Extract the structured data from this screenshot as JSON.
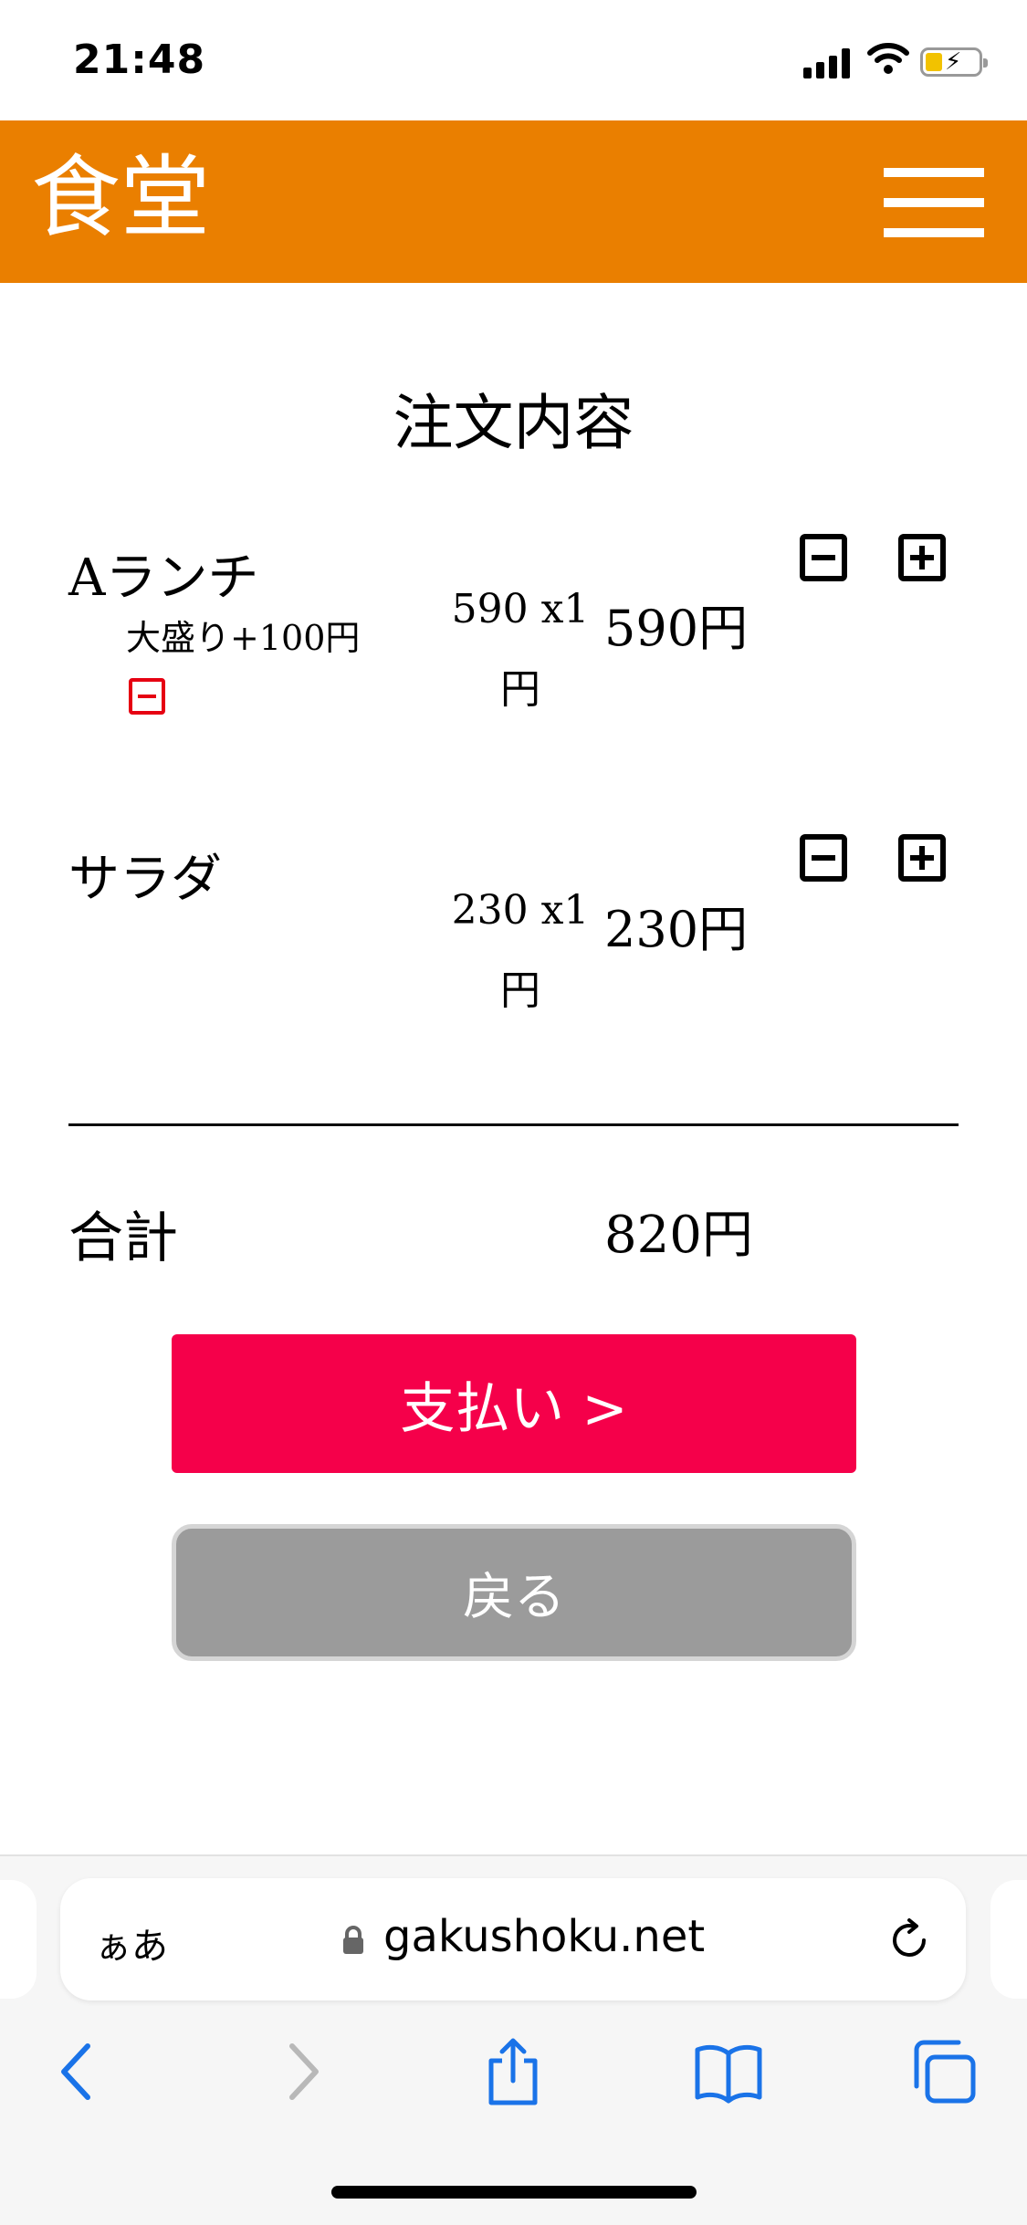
{
  "status_bar": {
    "time": "21:48"
  },
  "header": {
    "logo": "食堂"
  },
  "page": {
    "title": "注文内容"
  },
  "order_items": [
    {
      "name": "Aランチ",
      "option": "大盛り+100円",
      "unit_line1": "590 x1",
      "unit_line2": "円",
      "line_total": "590円"
    },
    {
      "name": "サラダ",
      "unit_line1": "230 x1",
      "unit_line2": "円",
      "line_total": "230円"
    }
  ],
  "total": {
    "label": "合計",
    "value": "820円"
  },
  "buttons": {
    "pay": "支払い >",
    "back": "戻る"
  },
  "browser": {
    "aa": "ぁあ",
    "url": "gakushoku.net"
  },
  "colors": {
    "header": "#ea7f00",
    "pay_button": "#f5004a",
    "back_button": "#9b9b9b",
    "option_remove": "#e60012"
  }
}
